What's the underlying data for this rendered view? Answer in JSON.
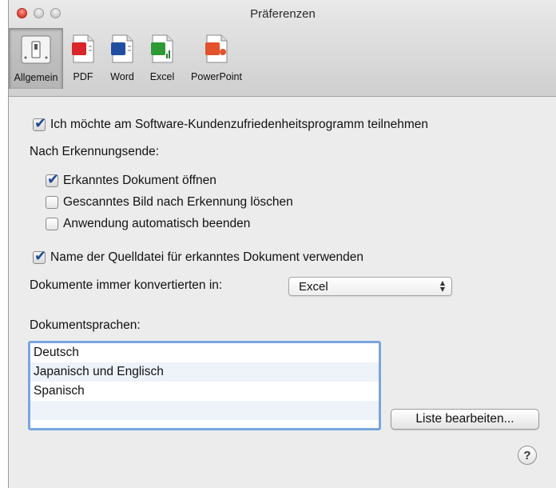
{
  "window": {
    "title": "Präferenzen"
  },
  "toolbar": {
    "items": [
      {
        "label": "Allgemein",
        "icon": "switch-icon"
      },
      {
        "label": "PDF",
        "icon": "pdf-document-icon"
      },
      {
        "label": "Word",
        "icon": "word-document-icon"
      },
      {
        "label": "Excel",
        "icon": "excel-document-icon"
      },
      {
        "label": "PowerPoint",
        "icon": "powerpoint-document-icon"
      }
    ]
  },
  "settings": {
    "participate_label": "Ich möchte am Software-Kundenzufriedenheitsprogramm teilnehmen",
    "participate_checked": true,
    "after_recognition_heading": "Nach Erkennungsende:",
    "open_document_label": "Erkanntes Dokument öffnen",
    "open_document_checked": true,
    "delete_scan_label": "Gescanntes Bild nach Erkennung löschen",
    "delete_scan_checked": false,
    "quit_app_label": "Anwendung automatisch beenden",
    "quit_app_checked": false,
    "use_source_name_label": "Name der Quelldatei für erkanntes Dokument verwenden",
    "use_source_name_checked": true,
    "convert_to_label": "Dokumente immer konvertierten in:",
    "convert_to_value": "Excel",
    "languages_heading": "Dokumentsprachen:",
    "languages": [
      "Deutsch",
      "Japanisch und Englisch",
      "Spanisch",
      ""
    ],
    "edit_list_button": "Liste bearbeiten...",
    "help_button": "?"
  },
  "colors": {
    "check_accent": "#1e4a9a",
    "focus_ring": "#78a6df",
    "close_button": "#e0443a"
  }
}
